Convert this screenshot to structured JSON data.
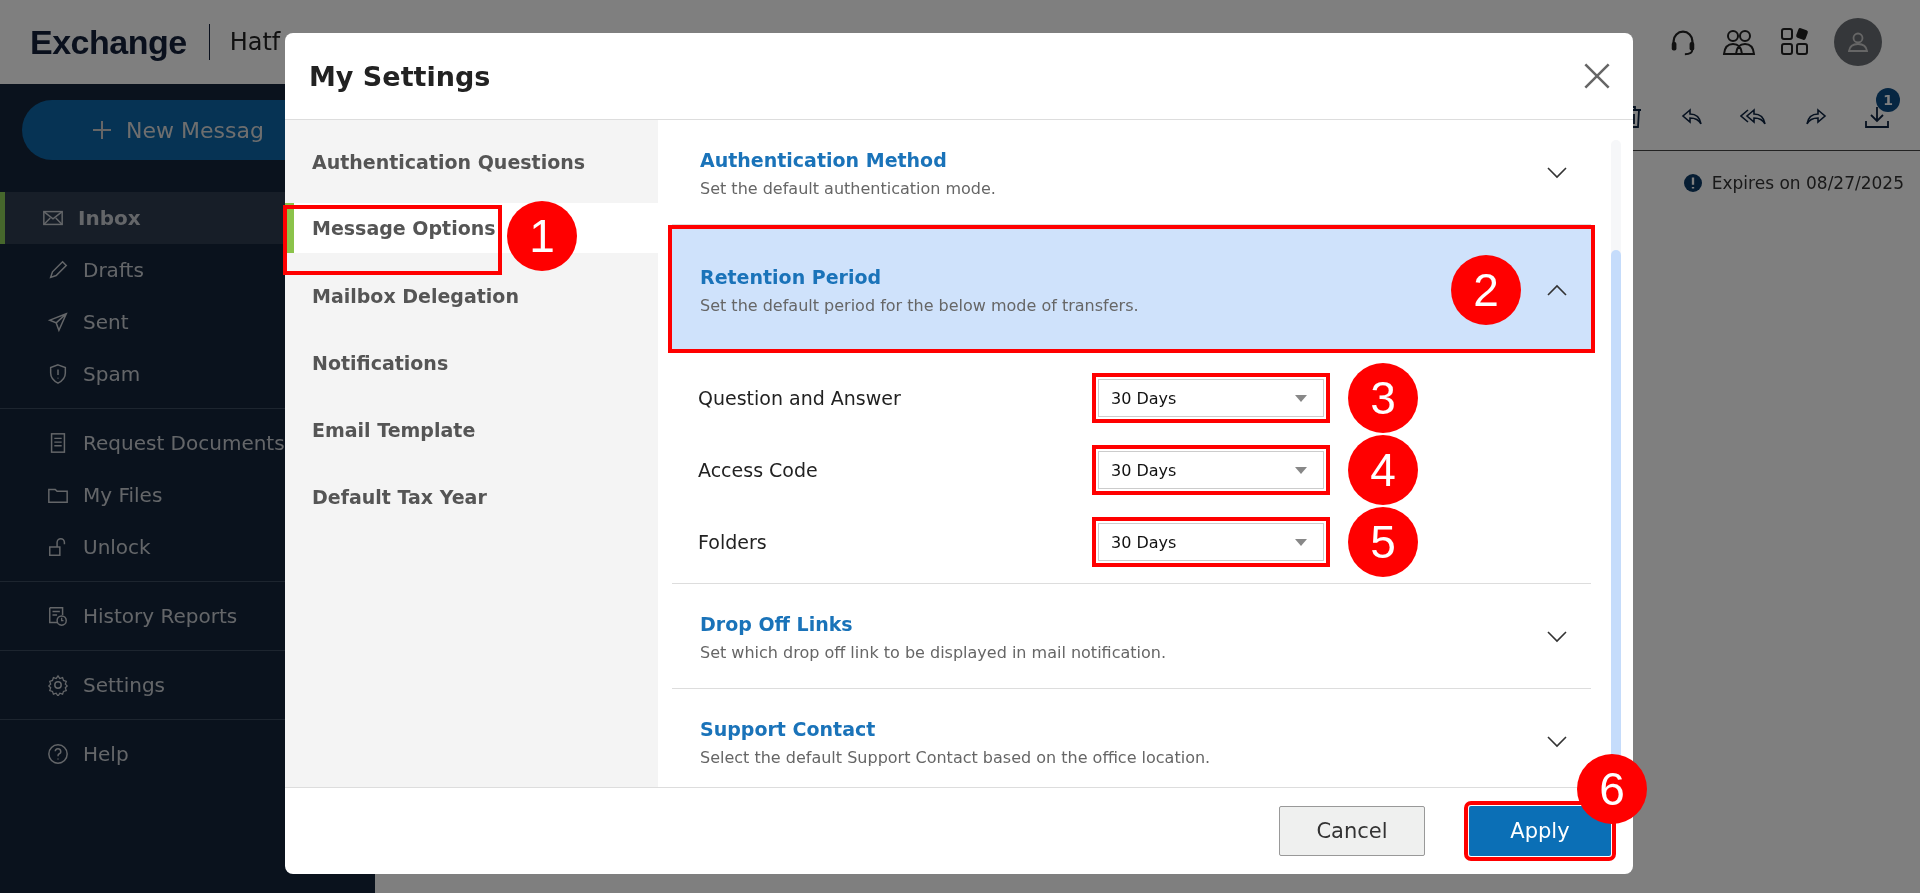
{
  "app": {
    "logo": "Exchange",
    "account": "Hatf",
    "new_message": "New Messag",
    "nav_groups": [
      [
        {
          "label": "Inbox",
          "selected": true
        },
        {
          "label": "Drafts",
          "selected": false
        },
        {
          "label": "Sent",
          "selected": false
        },
        {
          "label": "Spam",
          "selected": false
        }
      ],
      [
        {
          "label": "Request Documents",
          "selected": false
        },
        {
          "label": "My Files",
          "selected": false
        },
        {
          "label": "Unlock",
          "selected": false
        }
      ],
      [
        {
          "label": "History Reports",
          "selected": false
        }
      ],
      [
        {
          "label": "Settings",
          "selected": false
        }
      ],
      [
        {
          "label": "Help",
          "selected": false
        }
      ]
    ],
    "download_badge": "1",
    "expiry": "Expires on 08/27/2025"
  },
  "dialog": {
    "title": "My Settings",
    "nav": [
      {
        "label": "Authentication Questions",
        "selected": false,
        "highlighted": false
      },
      {
        "label": "Message Options",
        "selected": true,
        "highlighted": true,
        "callout": "1"
      },
      {
        "label": "Mailbox Delegation",
        "selected": false,
        "highlighted": false
      },
      {
        "label": "Notifications",
        "selected": false,
        "highlighted": false
      },
      {
        "label": "Email Template",
        "selected": false,
        "highlighted": false
      },
      {
        "label": "Default Tax Year",
        "selected": false,
        "highlighted": false
      }
    ],
    "sections": [
      {
        "title": "Authentication Method",
        "description": "Set the default authentication mode.",
        "expanded": false,
        "highlighted": false
      },
      {
        "title": "Retention Period",
        "description": "Set the default period for the below mode of transfers.",
        "expanded": true,
        "highlighted": true,
        "callout": "2",
        "fields": [
          {
            "label": "Question and Answer",
            "value": "30 Days",
            "highlighted": true,
            "callout": "3"
          },
          {
            "label": "Access Code",
            "value": "30 Days",
            "highlighted": true,
            "callout": "4"
          },
          {
            "label": "Folders",
            "value": "30 Days",
            "highlighted": true,
            "callout": "5"
          }
        ]
      },
      {
        "title": "Drop Off Links",
        "description": "Set which drop off link to be displayed in mail notification.",
        "expanded": false,
        "highlighted": false
      },
      {
        "title": "Support Contact",
        "description": "Select the default Support Contact based on the office location.",
        "expanded": false,
        "highlighted": false
      }
    ],
    "buttons": [
      {
        "label": "Cancel",
        "kind": "secondary",
        "highlighted": false
      },
      {
        "label": "Apply",
        "kind": "primary",
        "highlighted": true,
        "callout": "6"
      }
    ]
  }
}
